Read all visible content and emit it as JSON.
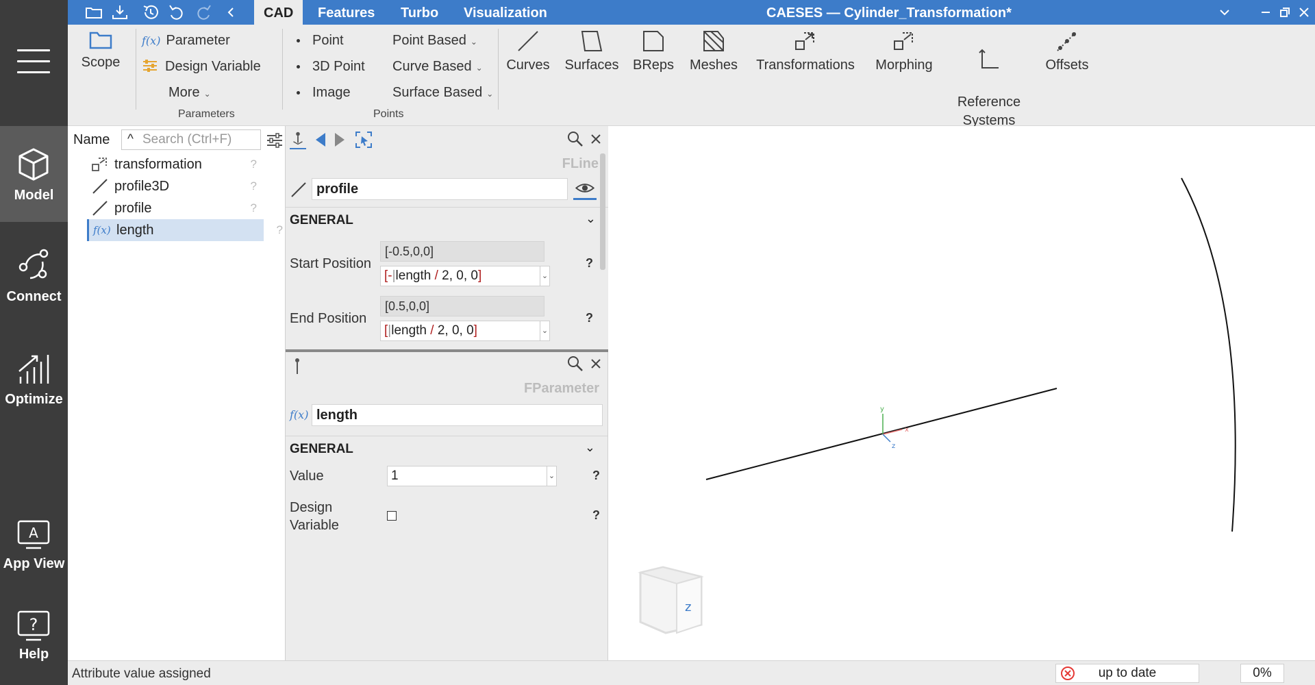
{
  "app": {
    "window_title": "CAESES — Cylinder_Transformation*",
    "ribbon_tabs": [
      "CAD",
      "Features",
      "Turbo",
      "Visualization"
    ],
    "active_tab": "CAD"
  },
  "nav": {
    "items": [
      {
        "label": "Model",
        "icon": "cube-icon",
        "active": true
      },
      {
        "label": "Connect",
        "icon": "connect-icon"
      },
      {
        "label": "Optimize",
        "icon": "optimize-icon"
      },
      {
        "label": "App View",
        "icon": "app-view-icon"
      },
      {
        "label": "Help",
        "icon": "help-icon"
      }
    ]
  },
  "ribbon": {
    "scope": "Scope",
    "parameter": "Parameter",
    "design_variable": "Design Variable",
    "more": "More",
    "parameters_group": "Parameters",
    "point": "Point",
    "point_3d": "3D Point",
    "image": "Image",
    "point_based": "Point Based",
    "curve_based": "Curve Based",
    "surface_based": "Surface Based",
    "points_group": "Points",
    "curves": "Curves",
    "surfaces": "Surfaces",
    "breps": "BReps",
    "meshes": "Meshes",
    "transformations": "Transformations",
    "morphing": "Morphing",
    "reference_systems": "Reference\nSystems",
    "offsets": "Offsets",
    "fx": "f(x)"
  },
  "tree": {
    "name_header": "Name",
    "search_placeholder": "Search (Ctrl+F)",
    "items": [
      {
        "label": "transformation",
        "icon": "transformation-icon"
      },
      {
        "label": "profile3D",
        "icon": "line-icon"
      },
      {
        "label": "profile",
        "icon": "line-icon"
      },
      {
        "label": "length",
        "icon": "fx-icon",
        "selected": true
      }
    ],
    "help": "?"
  },
  "props_top": {
    "type": "FLine",
    "name": "profile",
    "section": "GENERAL",
    "start_label": "Start Position",
    "start_value": "[-0.5,0,0]",
    "start_expr": {
      "open": "[-",
      "ref": "length",
      "op": " / ",
      "rest": "2, 0, 0",
      "close": "]"
    },
    "end_label": "End Position",
    "end_value": "[0.5,0,0]",
    "end_expr": {
      "open": "[",
      "ref": "length",
      "op": " / ",
      "rest": "2, 0, 0",
      "close": "]"
    },
    "help": "?"
  },
  "props_bottom": {
    "type": "FParameter",
    "fx": "f(x)",
    "name": "length",
    "section": "GENERAL",
    "value_label": "Value",
    "value": "1",
    "design_variable_label": "Design\nVariable",
    "design_variable_checked": false,
    "help": "?"
  },
  "viewport": {
    "axis_y": "y",
    "axis_z": "z",
    "axis_x": "x",
    "cube_face": "z"
  },
  "status": {
    "message": "Attribute value assigned",
    "state": "up to date",
    "progress": "0%",
    "error_color": "#e53935"
  },
  "colors": {
    "accent": "#3d7cc9",
    "nav_bg": "#3c3c3c",
    "nav_active": "#5b5b5b"
  }
}
